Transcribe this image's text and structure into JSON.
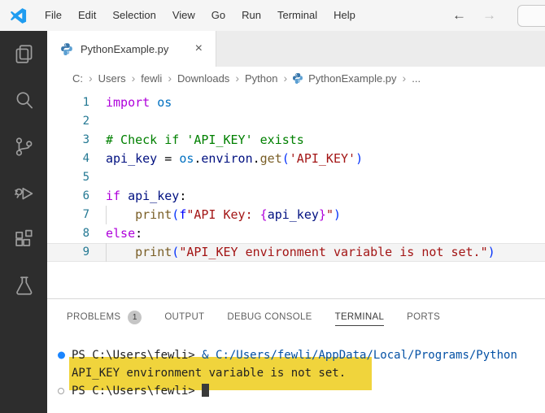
{
  "titlebar": {
    "menu_items": [
      "File",
      "Edit",
      "Selection",
      "View",
      "Go",
      "Run",
      "Terminal",
      "Help"
    ],
    "back_arrow": "←",
    "forward_arrow": "→"
  },
  "activity_bar": {
    "icons": [
      "explorer",
      "search",
      "source-control",
      "run-and-debug",
      "extensions",
      "testing"
    ]
  },
  "editor_tab": {
    "label": "PythonExample.py",
    "close": "×"
  },
  "breadcrumb": {
    "items": [
      "C:",
      "Users",
      "fewli",
      "Downloads",
      "Python",
      "PythonExample.py",
      "..."
    ],
    "separator": "›"
  },
  "editor": {
    "lines": [
      {
        "num": 1,
        "tokens": [
          {
            "text": "import",
            "style": "keyword"
          },
          {
            "text": " ",
            "style": "plain"
          },
          {
            "text": "os",
            "style": "module"
          }
        ]
      },
      {
        "num": 2,
        "tokens": []
      },
      {
        "num": 3,
        "tokens": [
          {
            "text": "# Check if 'API_KEY' exists",
            "style": "comment"
          }
        ]
      },
      {
        "num": 4,
        "tokens": [
          {
            "text": "api_key",
            "style": "variable"
          },
          {
            "text": " = ",
            "style": "plain"
          },
          {
            "text": "os",
            "style": "module"
          },
          {
            "text": ".",
            "style": "plain"
          },
          {
            "text": "environ",
            "style": "variable"
          },
          {
            "text": ".",
            "style": "plain"
          },
          {
            "text": "get",
            "style": "function"
          },
          {
            "text": "(",
            "style": "bracket"
          },
          {
            "text": "'API_KEY'",
            "style": "string"
          },
          {
            "text": ")",
            "style": "bracket"
          }
        ]
      },
      {
        "num": 5,
        "tokens": []
      },
      {
        "num": 6,
        "tokens": [
          {
            "text": "if",
            "style": "keyword"
          },
          {
            "text": " ",
            "style": "plain"
          },
          {
            "text": "api_key",
            "style": "variable"
          },
          {
            "text": ":",
            "style": "plain"
          }
        ]
      },
      {
        "num": 7,
        "indent_guide": true,
        "tokens": [
          {
            "text": "    ",
            "style": "plain"
          },
          {
            "text": "print",
            "style": "function"
          },
          {
            "text": "(",
            "style": "bracket"
          },
          {
            "text": "f",
            "style": "fstring"
          },
          {
            "text": "\"API Key: ",
            "style": "string"
          },
          {
            "text": "{",
            "style": "brace"
          },
          {
            "text": "api_key",
            "style": "variable"
          },
          {
            "text": "}",
            "style": "brace"
          },
          {
            "text": "\"",
            "style": "string"
          },
          {
            "text": ")",
            "style": "bracket"
          }
        ]
      },
      {
        "num": 8,
        "tokens": [
          {
            "text": "else",
            "style": "keyword"
          },
          {
            "text": ":",
            "style": "plain"
          }
        ]
      },
      {
        "num": 9,
        "indent_guide": true,
        "current": true,
        "tokens": [
          {
            "text": "    ",
            "style": "plain"
          },
          {
            "text": "print",
            "style": "function"
          },
          {
            "text": "(",
            "style": "bracket"
          },
          {
            "text": "\"API_KEY environment variable is not set.\"",
            "style": "string"
          },
          {
            "text": ")",
            "style": "bracket"
          }
        ]
      }
    ]
  },
  "panel": {
    "tabs": [
      {
        "label": "PROBLEMS",
        "badge": "1",
        "active": false
      },
      {
        "label": "OUTPUT",
        "active": false
      },
      {
        "label": "DEBUG CONSOLE",
        "active": false
      },
      {
        "label": "TERMINAL",
        "active": true
      },
      {
        "label": "PORTS",
        "active": false
      }
    ]
  },
  "terminal": {
    "lines": [
      {
        "decoration": "filled",
        "segments": [
          {
            "text": "PS C:\\Users\\fewli> ",
            "style": "plain"
          },
          {
            "text": "& C:/Users/fewli/AppData/Local/Programs/Python",
            "style": "command"
          }
        ]
      },
      {
        "decoration": "none",
        "highlighted": true,
        "segments": [
          {
            "text": "API_KEY environment variable is not set.",
            "style": "plain"
          }
        ]
      },
      {
        "decoration": "hollow",
        "cursor": true,
        "segments": [
          {
            "text": "PS C:\\Users\\fewli> ",
            "style": "plain"
          }
        ]
      }
    ]
  },
  "colors": {
    "accent_blue": "#1f9cf0",
    "highlight_yellow": "#f0d43c",
    "activity_bar_bg": "#2d2d2d",
    "keyword": "#af00db",
    "string": "#a31515",
    "comment": "#008000",
    "function": "#795e26",
    "variable": "#001080",
    "module": "#0070c1",
    "bracket": "#0431fa",
    "terminal_command": "#0451a5"
  }
}
